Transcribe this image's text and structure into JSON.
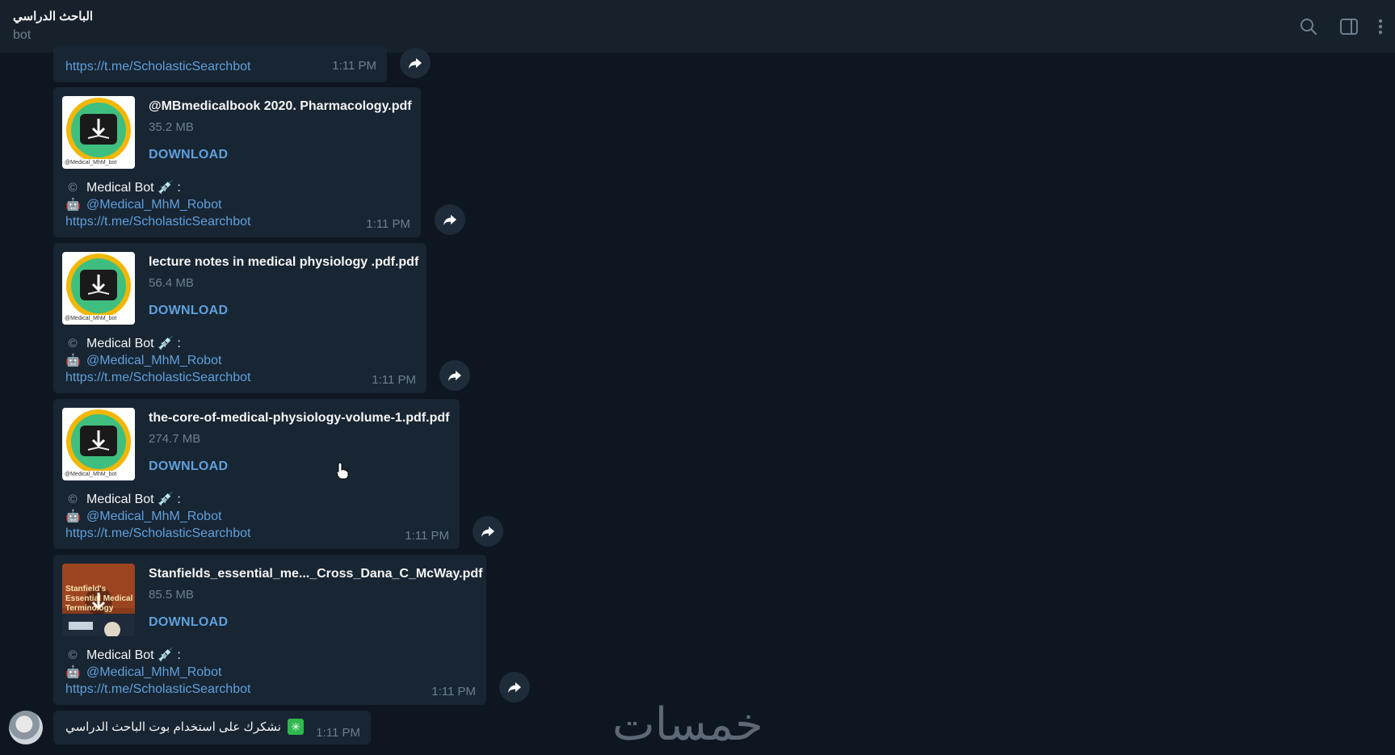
{
  "header": {
    "title": "الباحث الدراسي",
    "subtitle": "bot",
    "icons": [
      "search-icon",
      "sidebar-toggle-icon",
      "more-vertical-icon"
    ]
  },
  "partial_message": {
    "link": "https://t.me/ScholasticSearchbot",
    "time": "1:11 PM"
  },
  "messages": [
    {
      "file_name": "@MBmedicalbook 2020. Pharmacology.pdf",
      "file_size": "35.2 MB",
      "download_label": "DOWNLOAD",
      "caption_line1": "Medical Bot 💉 :",
      "caption_handle": "@Medical_MhM_Robot",
      "caption_link": "https://t.me/ScholasticSearchbot",
      "time": "1:11 PM",
      "thumb_text": "@Medical_MhM_bot"
    },
    {
      "file_name": "lecture notes in medical physiology .pdf.pdf",
      "file_size": "56.4 MB",
      "download_label": "DOWNLOAD",
      "caption_line1": "Medical Bot 💉 :",
      "caption_handle": "@Medical_MhM_Robot",
      "caption_link": "https://t.me/ScholasticSearchbot",
      "time": "1:11 PM",
      "thumb_text": "@Medical_MhM_bot"
    },
    {
      "file_name": "the-core-of-medical-physiology-volume-1.pdf.pdf",
      "file_size": "274.7 MB",
      "download_label": "DOWNLOAD",
      "caption_line1": "Medical Bot 💉 :",
      "caption_handle": "@Medical_MhM_Robot",
      "caption_link": "https://t.me/ScholasticSearchbot",
      "time": "1:11 PM",
      "thumb_text": "@Medical_MhM_bot"
    },
    {
      "file_name": "Stanfields_essential_me..._Cross_Dana_C_McWay.pdf",
      "file_size": "85.5 MB",
      "download_label": "DOWNLOAD",
      "caption_line1": "Medical Bot 💉 :",
      "caption_handle": "@Medical_MhM_Robot",
      "caption_link": "https://t.me/ScholasticSearchbot",
      "time": "1:11 PM",
      "thumb_text": "Stanfield's Essential Medical Terminology"
    }
  ],
  "last_message": {
    "text": "نشكرك على استخدام بوت الباحث الدراسي",
    "emoji": "✳️",
    "time": "1:11 PM"
  },
  "watermark": "خمسات",
  "colors": {
    "background": "#0e1621",
    "header": "#17212b",
    "bubble": "#182533",
    "link": "#5fa0dc",
    "muted": "#6d7f8f"
  }
}
